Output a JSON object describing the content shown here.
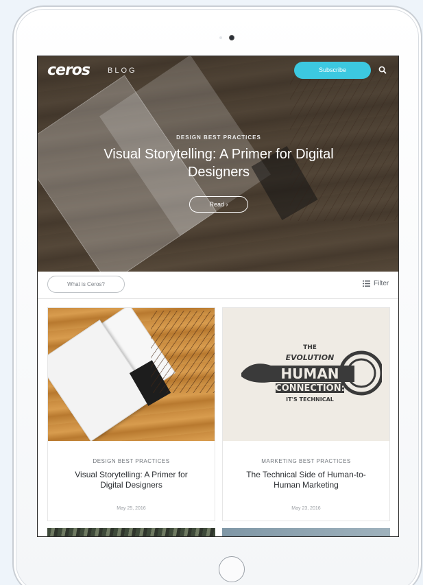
{
  "header": {
    "logo": "ceros",
    "section": "BLOG",
    "subscribe_label": "Subscribe"
  },
  "hero": {
    "category": "DESIGN BEST PRACTICES",
    "title": "Visual Storytelling: A Primer for Digital Designers",
    "read_label": "Read ›"
  },
  "filterbar": {
    "what_label": "What is Ceros?",
    "filter_label": "Filter"
  },
  "cards": [
    {
      "category": "DESIGN BEST PRACTICES",
      "title": "Visual Storytelling: A Primer for Digital Designers",
      "date": "May 25, 2016"
    },
    {
      "category": "MARKETING BEST PRACTICES",
      "title": "The Technical Side of Human-to-Human Marketing",
      "date": "May 23, 2016",
      "image_text": [
        "THE",
        "EVOLUTION",
        "HUMAN",
        "CONNECTION:",
        "IT'S TECHNICAL"
      ]
    }
  ],
  "colors": {
    "accent": "#3cc8e0",
    "text": "#2c2f33"
  },
  "icons": {
    "search": "search-icon",
    "filter": "list-icon"
  }
}
